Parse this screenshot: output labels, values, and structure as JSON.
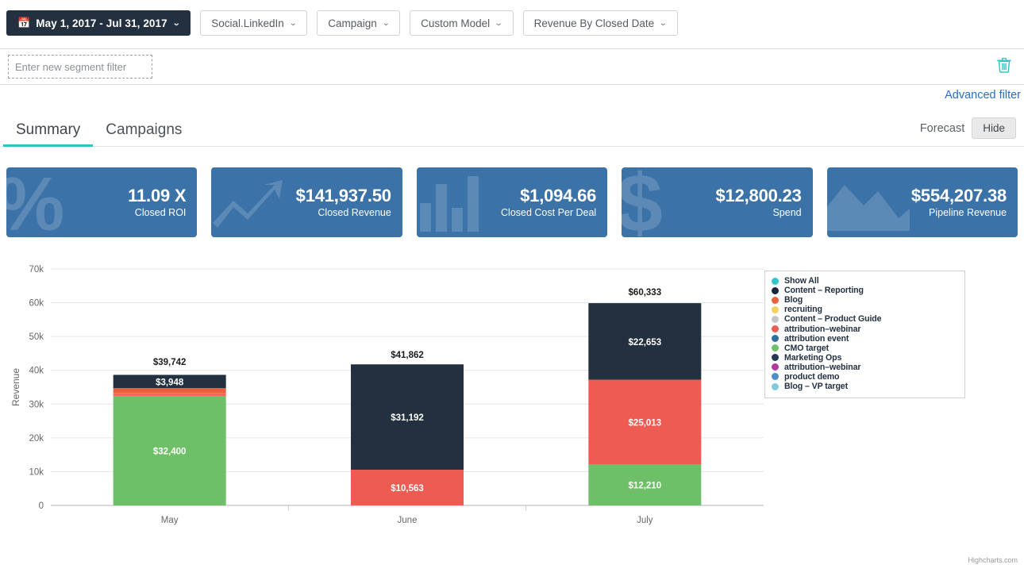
{
  "toolbar": {
    "date_range": {
      "icon": "calendar-icon",
      "label": "May 1, 2017 - Jul 31, 2017",
      "caret": "⌄"
    },
    "filters": [
      {
        "name": "channel",
        "label": "Social.LinkedIn",
        "caret": "⌄"
      },
      {
        "name": "campaign",
        "label": "Campaign",
        "caret": "⌄"
      },
      {
        "name": "model",
        "label": "Custom Model",
        "caret": "⌄"
      },
      {
        "name": "metric",
        "label": "Revenue By Closed Date",
        "caret": "⌄"
      }
    ]
  },
  "segment": {
    "placeholder": "Enter new segment filter",
    "value": "",
    "delete_icon": "trash-icon",
    "advanced_filter_label": "Advanced filter",
    "advanced_filter_color": "#2a6ebb"
  },
  "tabs": [
    {
      "name": "summary",
      "label": "Summary",
      "active": true
    },
    {
      "name": "campaigns",
      "label": "Campaigns",
      "active": false
    }
  ],
  "tab_accent_color": "#2ec4c4",
  "forecast": {
    "label": "Forecast",
    "toggle_label": "Hide"
  },
  "kpis": [
    {
      "name": "closed-roi",
      "value": "11.09 X",
      "label": "Closed ROI",
      "icon": "percent-icon"
    },
    {
      "name": "closed-revenue",
      "value": "$141,937.50",
      "label": "Closed Revenue",
      "icon": "trend-up-icon"
    },
    {
      "name": "closed-cost-per-deal",
      "value": "$1,094.66",
      "label": "Closed Cost Per Deal",
      "icon": "bar-chart-icon"
    },
    {
      "name": "spend",
      "value": "$12,800.23",
      "label": "Spend",
      "icon": "dollar-icon"
    },
    {
      "name": "pipeline-revenue",
      "value": "$554,207.38",
      "label": "Pipeline Revenue",
      "icon": "area-chart-icon"
    }
  ],
  "kpi_card_color": "#3b72a8",
  "chart_data": {
    "type": "bar",
    "stacked": true,
    "title": "",
    "xlabel": "",
    "ylabel": "Revenue",
    "categories": [
      "May",
      "June",
      "July"
    ],
    "ylim": [
      0,
      70000
    ],
    "ytick_labels": [
      "0",
      "10k",
      "20k",
      "30k",
      "40k",
      "50k",
      "60k",
      "70k"
    ],
    "ytick_values": [
      0,
      10000,
      20000,
      30000,
      40000,
      50000,
      60000,
      70000
    ],
    "grid": true,
    "legend_position": "top-right",
    "totals": [
      {
        "category": "May",
        "label": "$39,742",
        "value": 39742
      },
      {
        "category": "June",
        "label": "$41,862",
        "value": 41862
      },
      {
        "category": "July",
        "label": "$60,333",
        "value": 60333
      }
    ],
    "stacks": [
      {
        "category": "May",
        "segments": [
          {
            "series": "CMO target",
            "value": 32400,
            "label": "$32,400",
            "color": "#6dc067",
            "show_label": true
          },
          {
            "series": "attribution-webinar",
            "value": 900,
            "label": "",
            "color": "#ee6a5e",
            "show_label": false
          },
          {
            "series": "Blog",
            "value": 1400,
            "label": "",
            "color": "#e8603c",
            "show_label": false
          },
          {
            "series": "Content - Reporting",
            "value": 3948,
            "label": "$3,948",
            "color": "#22303f",
            "show_label": true
          }
        ]
      },
      {
        "category": "June",
        "segments": [
          {
            "series": "attribution-webinar",
            "value": 10563,
            "label": "$10,563",
            "color": "#ee5b52",
            "show_label": true
          },
          {
            "series": "Content - Reporting",
            "value": 31192,
            "label": "$31,192",
            "color": "#22303f",
            "show_label": true
          }
        ]
      },
      {
        "category": "July",
        "segments": [
          {
            "series": "CMO target",
            "value": 12210,
            "label": "$12,210",
            "color": "#6dc067",
            "show_label": true
          },
          {
            "series": "attribution-webinar",
            "value": 25013,
            "label": "$25,013",
            "color": "#ee5b52",
            "show_label": true
          },
          {
            "series": "Content - Reporting",
            "value": 22653,
            "label": "$22,653",
            "color": "#22303f",
            "show_label": true
          }
        ]
      }
    ],
    "legend": [
      {
        "label": "Show All",
        "color": "#2fc7c9"
      },
      {
        "label": "Content – Reporting",
        "color": "#1a2738"
      },
      {
        "label": "Blog",
        "color": "#e8603c"
      },
      {
        "label": "recruiting",
        "color": "#f6cf5e"
      },
      {
        "label": "Content – Product Guide",
        "color": "#c6c6c6"
      },
      {
        "label": "attribution–webinar",
        "color": "#ee5b52"
      },
      {
        "label": "attribution event",
        "color": "#2f6f9f"
      },
      {
        "label": "CMO target",
        "color": "#6dc067"
      },
      {
        "label": "Marketing Ops",
        "color": "#24384f"
      },
      {
        "label": "attribution–webinar",
        "color": "#b4379e"
      },
      {
        "label": "product demo",
        "color": "#4a90c4"
      },
      {
        "label": "Blog – VP target",
        "color": "#7fcbd8"
      }
    ]
  },
  "credits": "Highcharts.com"
}
